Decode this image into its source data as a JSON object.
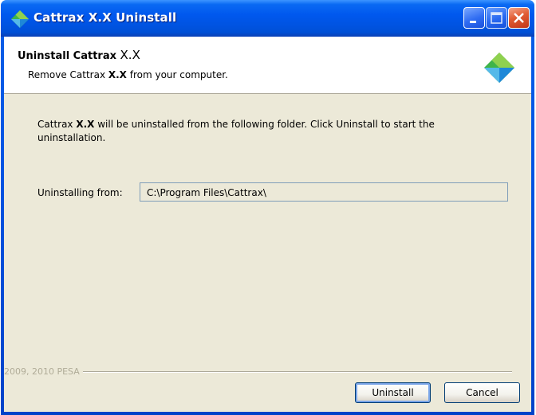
{
  "window": {
    "title": "Cattrax X.X Uninstall"
  },
  "header": {
    "title_prefix": "Uninstall Cattrax ",
    "title_version": "X.X",
    "subtitle_pre": "Remove Cattrax ",
    "subtitle_bold": "X.X",
    "subtitle_post": " from your computer."
  },
  "body": {
    "desc_pre": "Cattrax ",
    "desc_bold": "X.X",
    "desc_post": " will be uninstalled from the following folder. Click Uninstall to start the uninstallation.",
    "from_label": "Uninstalling from:",
    "from_path": "C:\\Program Files\\Cattrax\\"
  },
  "footer": {
    "branding": "2009, 2010 PESA",
    "uninstall_label": "Uninstall",
    "cancel_label": "Cancel"
  },
  "icons": {
    "app": "cattrax-diamond-icon",
    "minimize": "minimize-icon",
    "maximize": "maximize-icon",
    "close": "close-icon"
  },
  "colors": {
    "titlebar": "#0058ee",
    "client_bg": "#ece9d8",
    "logo_green": "#3fb44a",
    "logo_blue": "#1e88d8",
    "close_red": "#e05b33"
  }
}
